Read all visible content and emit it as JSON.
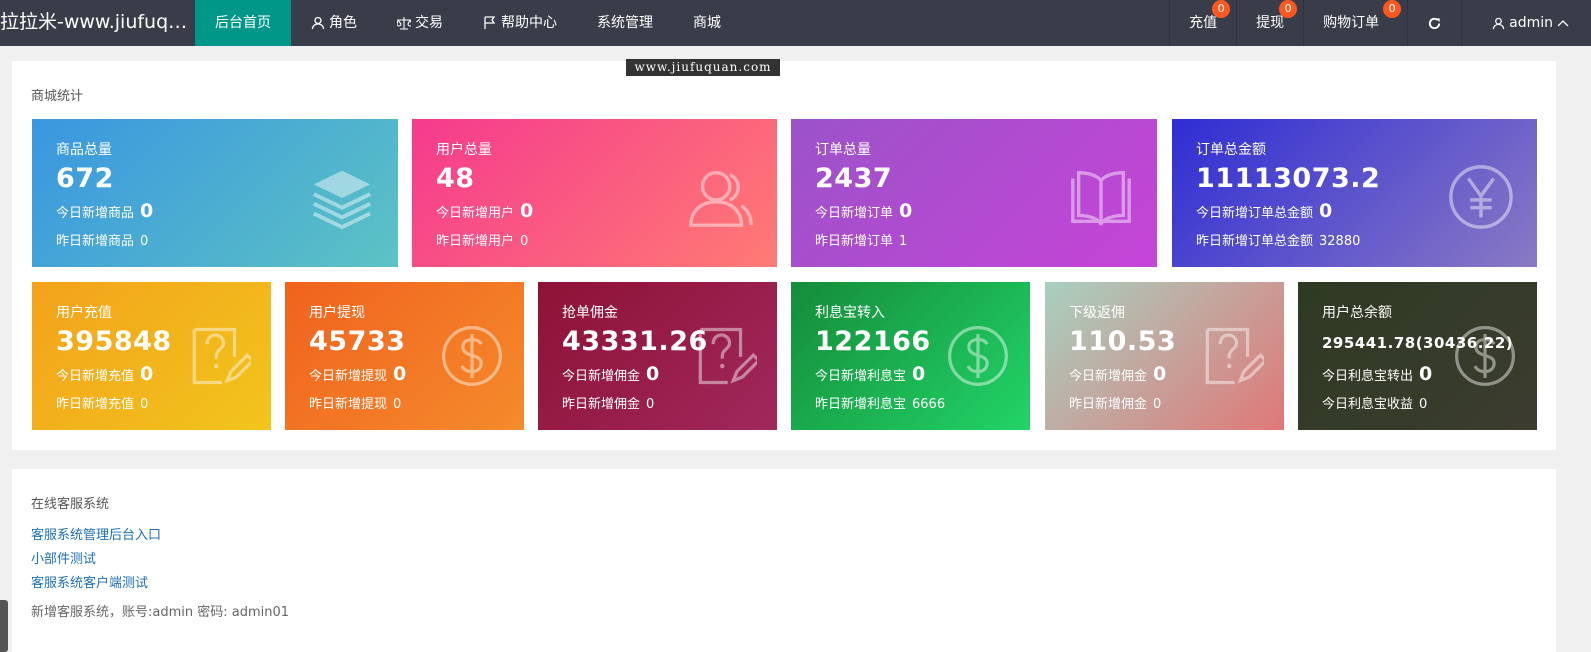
{
  "header": {
    "brand": "拉拉米-www.jiufuqua...",
    "nav": [
      {
        "label": "后台首页",
        "icon": "",
        "active": true
      },
      {
        "label": "角色",
        "icon": "user-icon"
      },
      {
        "label": "交易",
        "icon": "scale-icon"
      },
      {
        "label": "帮助中心",
        "icon": "flag-icon"
      },
      {
        "label": "系统管理",
        "icon": ""
      },
      {
        "label": "商城",
        "icon": ""
      }
    ],
    "right": {
      "recharge": {
        "label": "充值",
        "badge": "0"
      },
      "withdraw": {
        "label": "提现",
        "badge": "0"
      },
      "orders": {
        "label": "购物订单",
        "badge": "0"
      },
      "refresh_icon": "refresh-icon",
      "user": {
        "label": "admin",
        "icon": "user-icon"
      }
    }
  },
  "watermark": "www.jiufuquan.com",
  "stats": {
    "title": "商城统计",
    "cards": [
      {
        "title": "商品总量",
        "value": "672",
        "today_label": "今日新增商品",
        "today_value": "0",
        "yesterday_label": "昨日新增商品",
        "yesterday_value": "0",
        "icon": "layers-icon",
        "gradient": [
          "#3a96e0",
          "#5cc3c4"
        ]
      },
      {
        "title": "用户总量",
        "value": "48",
        "today_label": "今日新增用户",
        "today_value": "0",
        "yesterday_label": "昨日新增用户",
        "yesterday_value": "0",
        "icon": "users-icon",
        "gradient": [
          "#f53a8e",
          "#ff7b74"
        ]
      },
      {
        "title": "订单总量",
        "value": "2437",
        "today_label": "今日新增订单",
        "today_value": "0",
        "yesterday_label": "昨日新增订单",
        "yesterday_value": "1",
        "icon": "book-icon",
        "gradient": [
          "#9b53c8",
          "#c644d8"
        ]
      },
      {
        "title": "订单总金额",
        "value": "11113073.2",
        "today_label": "今日新增订单总金额",
        "today_value": "0",
        "yesterday_label": "昨日新增订单总金额",
        "yesterday_value": "32880",
        "icon": "yen-icon",
        "gradient": [
          "#2f2dd4",
          "#8a7ac4"
        ]
      },
      {
        "title": "用户充值",
        "value": "395848",
        "today_label": "今日新增充值",
        "today_value": "0",
        "yesterday_label": "昨日新增充值",
        "yesterday_value": "0",
        "icon": "question-edit-icon",
        "gradient": [
          "#f3a21c",
          "#f2c51c"
        ]
      },
      {
        "title": "用户提现",
        "value": "45733",
        "today_label": "今日新增提现",
        "today_value": "0",
        "yesterday_label": "昨日新增提现",
        "yesterday_value": "0",
        "icon": "dollar-icon",
        "gradient": [
          "#f0621e",
          "#f58b2c"
        ]
      },
      {
        "title": "抢单佣金",
        "value": "43331.26",
        "today_label": "今日新增佣金",
        "today_value": "0",
        "yesterday_label": "昨日新增佣金",
        "yesterday_value": "0",
        "icon": "question-edit-icon",
        "gradient": [
          "#8e1236",
          "#a0285c"
        ]
      },
      {
        "title": "利息宝转入",
        "value": "122166",
        "today_label": "今日新增利息宝",
        "today_value": "0",
        "yesterday_label": "昨日新增利息宝",
        "yesterday_value": "6666",
        "icon": "dollar-icon",
        "gradient": [
          "#158c3a",
          "#22d468"
        ]
      },
      {
        "title": "下级返佣",
        "value": "110.53",
        "today_label": "今日新增佣金",
        "today_value": "0",
        "yesterday_label": "昨日新增佣金",
        "yesterday_value": "0",
        "icon": "question-edit-icon",
        "gradient": [
          "#a8d0c0",
          "#e07878"
        ]
      },
      {
        "title": "用户总余额",
        "value": "295441.78(30436.22)",
        "today_label": "今日利息宝转出",
        "today_value": "0",
        "yesterday_label": "今日利息宝收益",
        "yesterday_value": "0",
        "icon": "dollar-icon",
        "gradient": [
          "#2e3a22",
          "#3c3c30"
        ]
      }
    ]
  },
  "service": {
    "title": "在线客服系统",
    "links": [
      "客服系统管理后台入口",
      "小部件测试",
      "客服系统客户端测试"
    ],
    "note": "新增客服系统，账号:admin 密码: admin01"
  }
}
